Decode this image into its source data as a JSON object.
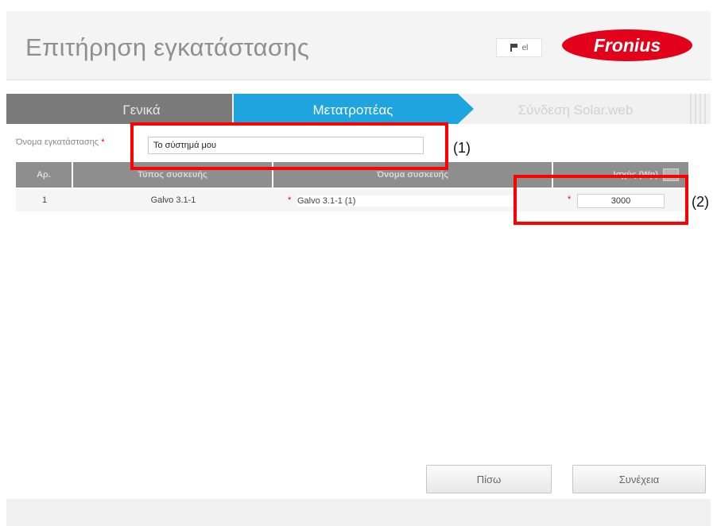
{
  "header": {
    "title": "Επιτήρηση εγκατάστασης",
    "language": {
      "code": "el",
      "icon": "flag-icon"
    },
    "logo_text": "Fronius",
    "brand_color": "#e2001a"
  },
  "steps": [
    {
      "label": "Γενικά",
      "state": "completed"
    },
    {
      "label": "Μετατροπέας",
      "state": "active"
    },
    {
      "label": "Σύνδεση Solar.web",
      "state": "pending"
    }
  ],
  "form": {
    "system_name_label": "Όνομα εγκατάστασης",
    "system_name_value": "Το σύστημά μου"
  },
  "table": {
    "columns": [
      "Αρ.",
      "Τύπος συσκευής",
      "Όνομα συσκευής",
      "Ισχύς (Wp)"
    ],
    "rows": [
      {
        "number": "1",
        "device_type": "Galvo 3.1-1",
        "device_name": "Galvo 3.1-1 (1)",
        "power": "3000"
      }
    ]
  },
  "callouts": {
    "one": "(1)",
    "two": "(2)"
  },
  "buttons": {
    "back": "Πίσω",
    "continue": "Συνέχεια"
  },
  "colors": {
    "active_step": "#1ea5df",
    "completed_step": "#7a7a7a",
    "highlight": "#ff0000",
    "required_star": "#e2001a"
  }
}
